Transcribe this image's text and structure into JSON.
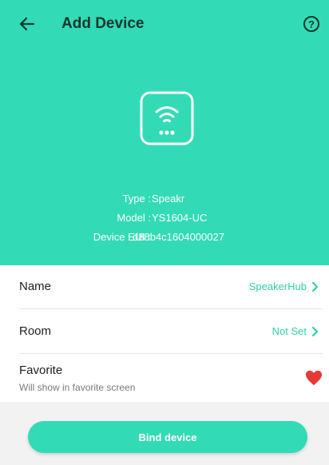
{
  "header": {
    "title": "Add Device",
    "help_glyph": "?",
    "back_icon": "arrow-left-icon",
    "device_icon": "wifi-hub-icon"
  },
  "device_info": {
    "type_label": "Type :",
    "type_value": "Speakr",
    "model_label": "Model :",
    "model_value": "YS1604-UC",
    "eui_label": "Device EUI :",
    "eui_value": "d88b4c1604000027"
  },
  "settings": {
    "name_label": "Name",
    "name_value": "SpeakerHub",
    "room_label": "Room",
    "room_value": "Not Set",
    "favorite_label": "Favorite",
    "favorite_subtext": "Will show in favorite screen",
    "favorite_on": true
  },
  "actions": {
    "bind_label": "Bind device"
  },
  "colors": {
    "accent": "#32dbb5",
    "value_text": "#2fd0ad",
    "heart": "#e53935"
  }
}
